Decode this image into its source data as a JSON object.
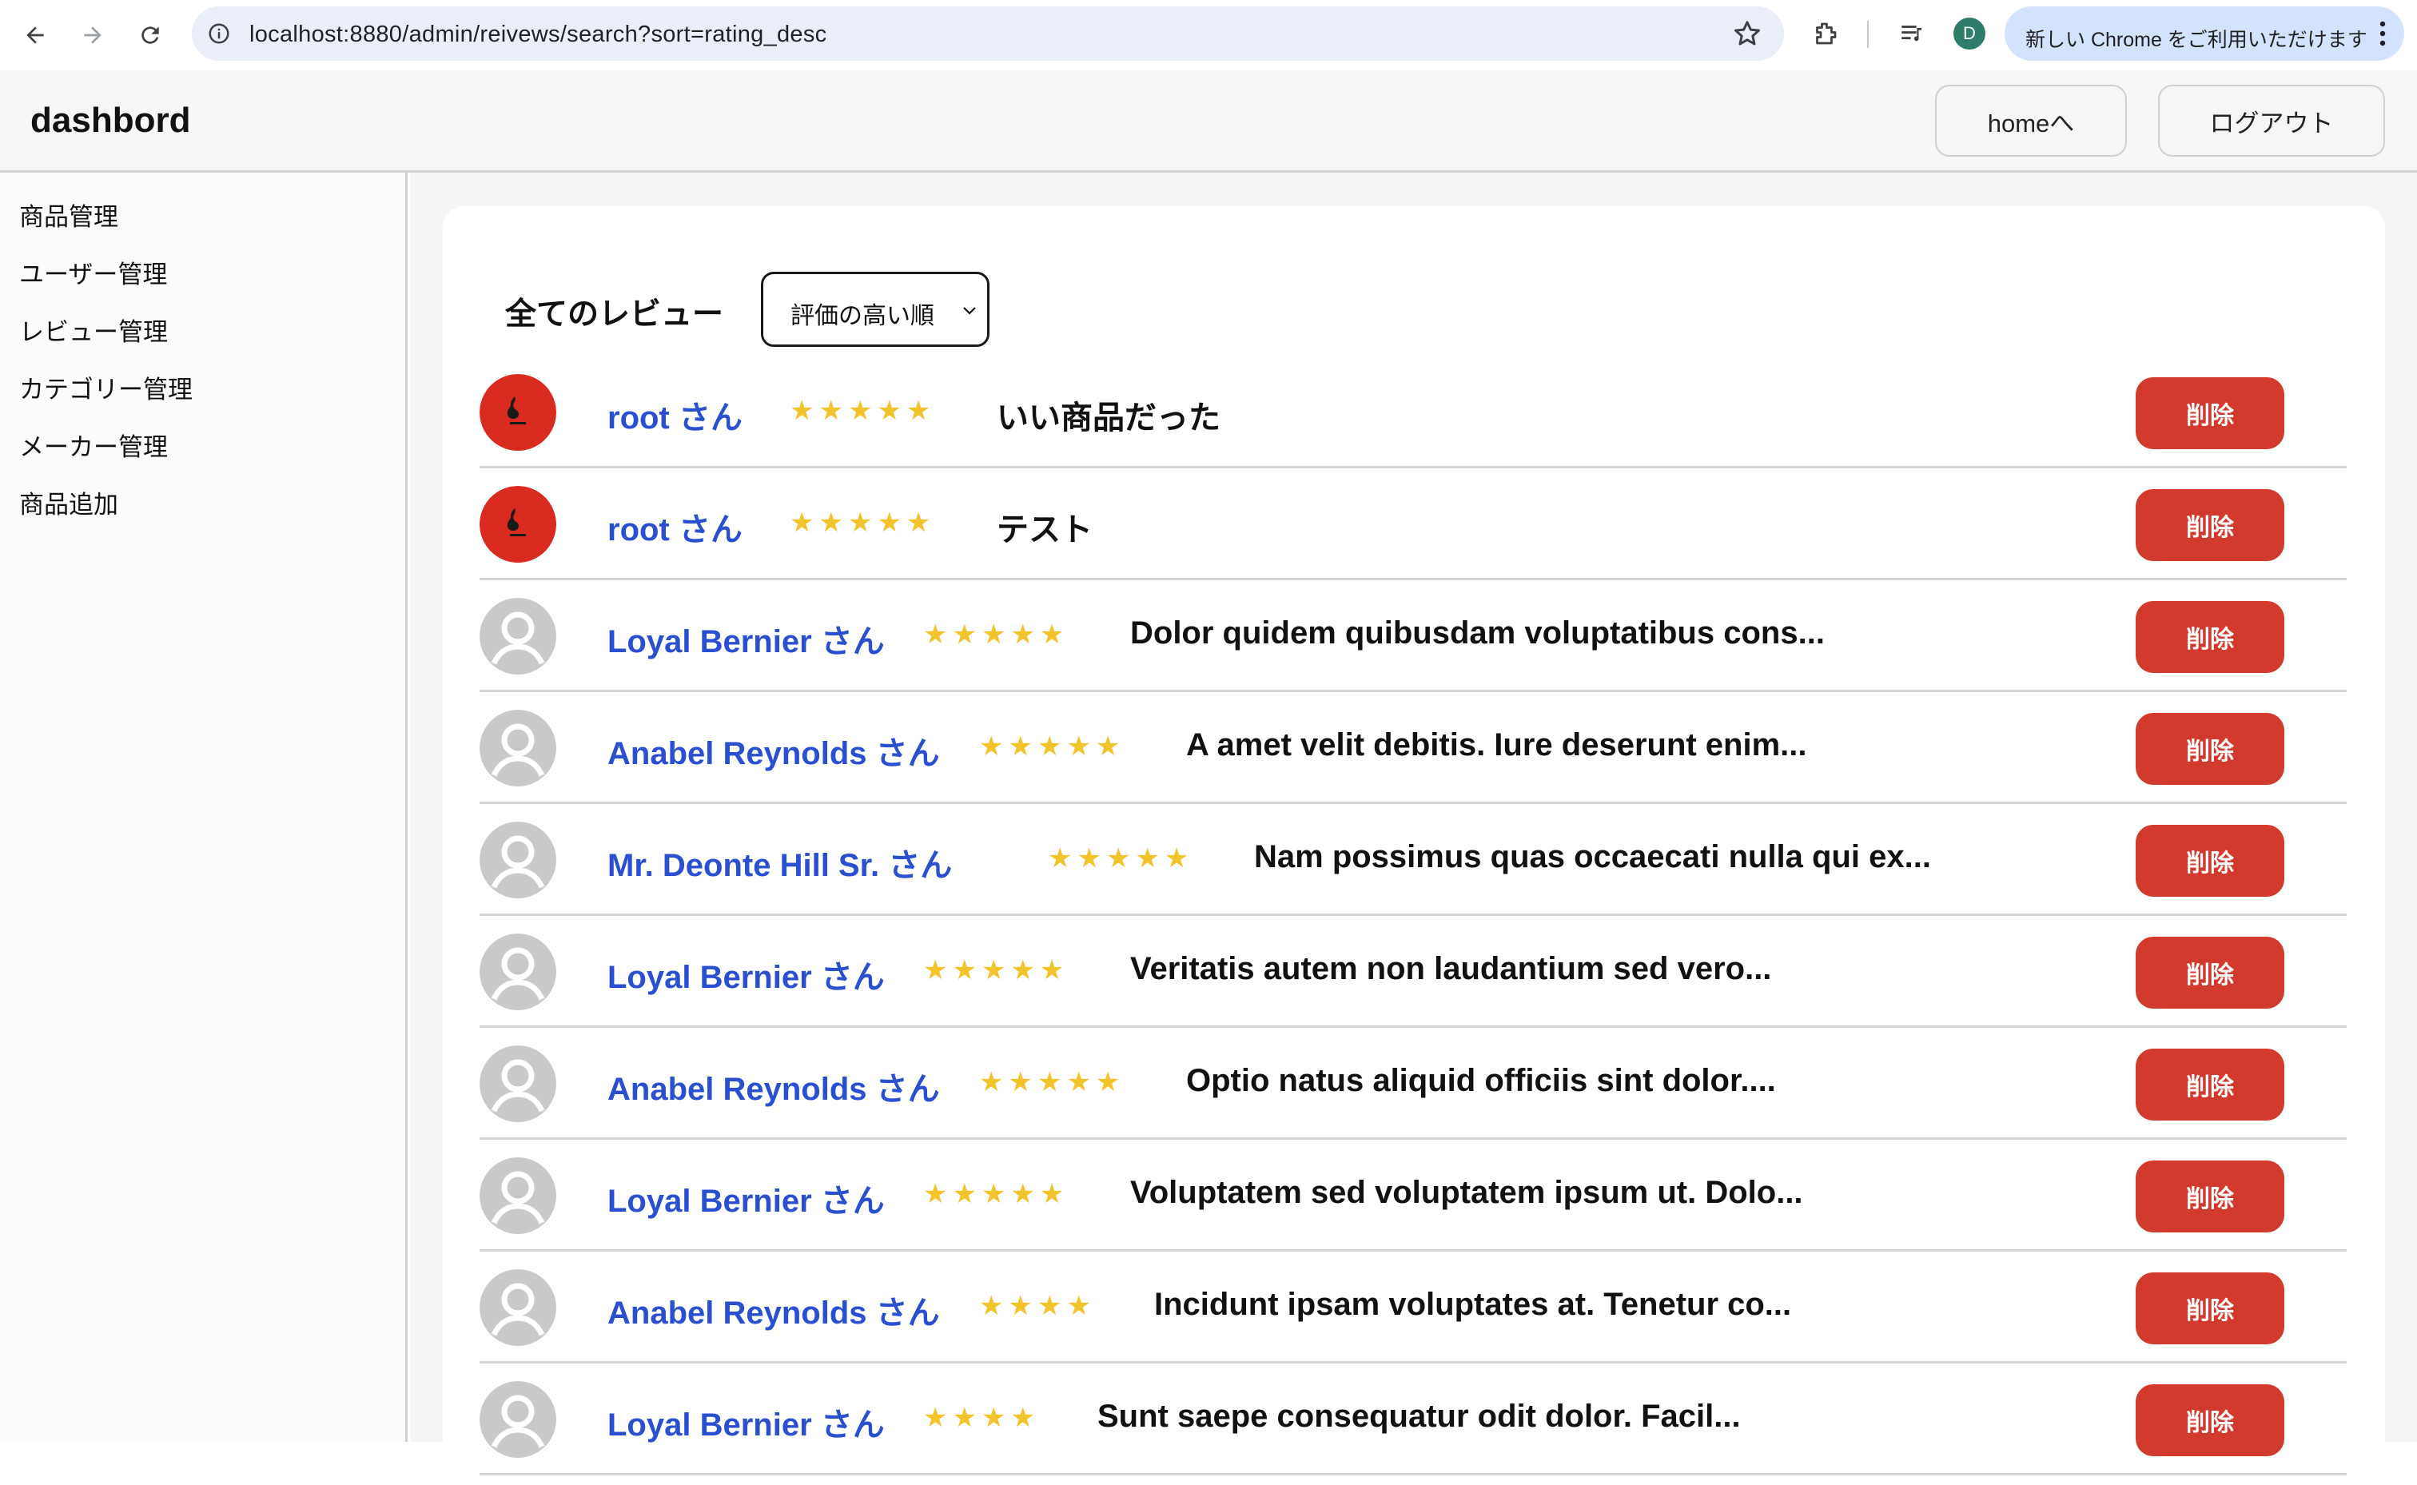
{
  "browser": {
    "url": "localhost:8880/admin/reivews/search?sort=rating_desc",
    "profile_initial": "D",
    "update_text": "新しい Chrome をご利用いただけます"
  },
  "header": {
    "brand": "dashbord",
    "home_button": "homeへ",
    "logout_button": "ログアウト"
  },
  "sidebar": {
    "items": [
      {
        "label": "商品管理"
      },
      {
        "label": "ユーザー管理"
      },
      {
        "label": "レビュー管理"
      },
      {
        "label": "カテゴリー管理"
      },
      {
        "label": "メーカー管理"
      },
      {
        "label": "商品追加"
      }
    ]
  },
  "main": {
    "title": "全てのレビュー",
    "sort_value": "評価の高い順",
    "delete_label": "削除",
    "reviews": [
      {
        "avatar": "custom",
        "name": "root さん",
        "rating": 5,
        "stars": "★★★★★",
        "text": "いい商品だった"
      },
      {
        "avatar": "custom",
        "name": "root さん",
        "rating": 5,
        "stars": "★★★★★",
        "text": "テスト"
      },
      {
        "avatar": "default",
        "name": "Loyal Bernier さん",
        "rating": 5,
        "stars": "★★★★★",
        "text": "Dolor quidem quibusdam voluptatibus cons..."
      },
      {
        "avatar": "default",
        "name": "Anabel Reynolds さん",
        "rating": 5,
        "stars": "★★★★★",
        "text": "A amet velit debitis. Iure deserunt enim..."
      },
      {
        "avatar": "default",
        "name": "Mr. Deonte Hill Sr. さん",
        "rating": 5,
        "stars": "★★★★★",
        "text": "Nam possimus quas occaecati nulla qui ex..."
      },
      {
        "avatar": "default",
        "name": "Loyal Bernier さん",
        "rating": 5,
        "stars": "★★★★★",
        "text": "Veritatis autem non laudantium sed vero..."
      },
      {
        "avatar": "default",
        "name": "Anabel Reynolds さん",
        "rating": 5,
        "stars": "★★★★★",
        "text": "Optio natus aliquid officiis sint dolor...."
      },
      {
        "avatar": "default",
        "name": "Loyal Bernier さん",
        "rating": 5,
        "stars": "★★★★★",
        "text": "Voluptatem sed voluptatem ipsum ut. Dolo..."
      },
      {
        "avatar": "default",
        "name": "Anabel Reynolds さん",
        "rating": 4,
        "stars": "★★★★",
        "text": "Incidunt ipsam voluptates at. Tenetur co..."
      },
      {
        "avatar": "default",
        "name": "Loyal Bernier さん",
        "rating": 4,
        "stars": "★★★★",
        "text": "Sunt saepe consequatur odit dolor. Facil..."
      }
    ]
  }
}
